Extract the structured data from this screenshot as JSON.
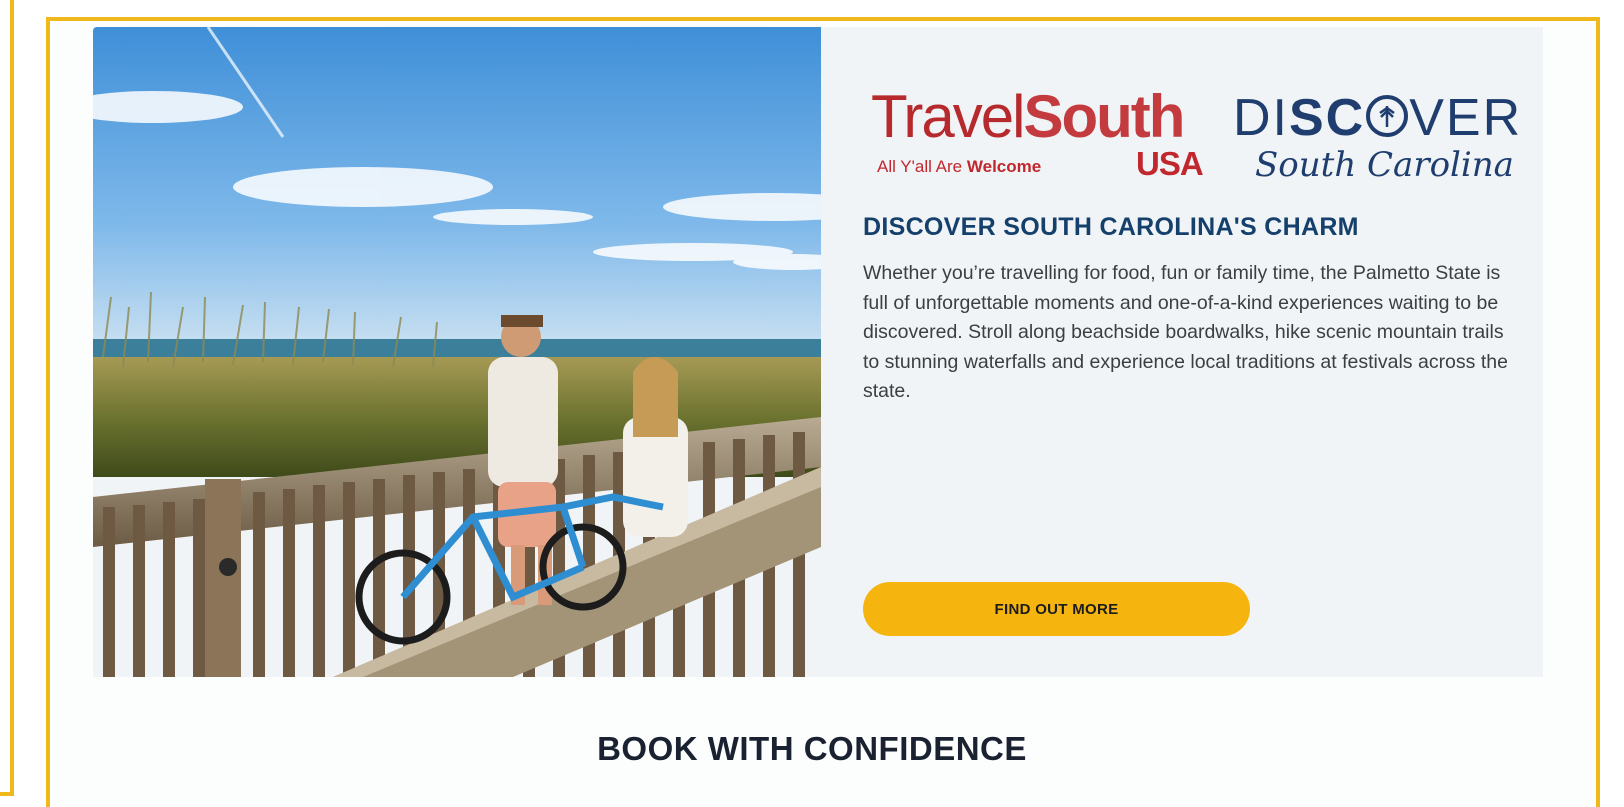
{
  "promo": {
    "photo_alt": "couple-walking-bikes-on-beach-boardwalk",
    "logos": {
      "travel_south": {
        "word_light": "Travel",
        "word_bold": "South",
        "tagline_prefix": "All Y'all Are ",
        "tagline_bold": "Welcome",
        "usa": "USA"
      },
      "discover_sc": {
        "word_a": "DI",
        "word_b": "SC",
        "word_c": "VER",
        "script": "South Carolina"
      }
    },
    "headline": "DISCOVER SOUTH CAROLINA'S CHARM",
    "body": "Whether you’re travelling for food, fun or family time, the Palmetto State is full of unforgettable moments and one-of-a-kind experiences waiting to be discovered. Stroll along beachside boardwalks, hike scenic mountain trails to stunning waterfalls and experience local traditions at festivals across the state.",
    "cta_label": "FIND OUT MORE"
  },
  "next_section": {
    "heading": "BOOK WITH CONFIDENCE"
  },
  "colors": {
    "frame_accent": "#f0b81a",
    "cta_background": "#f5b50e",
    "headline": "#15406b",
    "travel_south_red": "#c0282e",
    "discover_navy": "#1f3e6f",
    "card_background": "#f1f4f6"
  }
}
